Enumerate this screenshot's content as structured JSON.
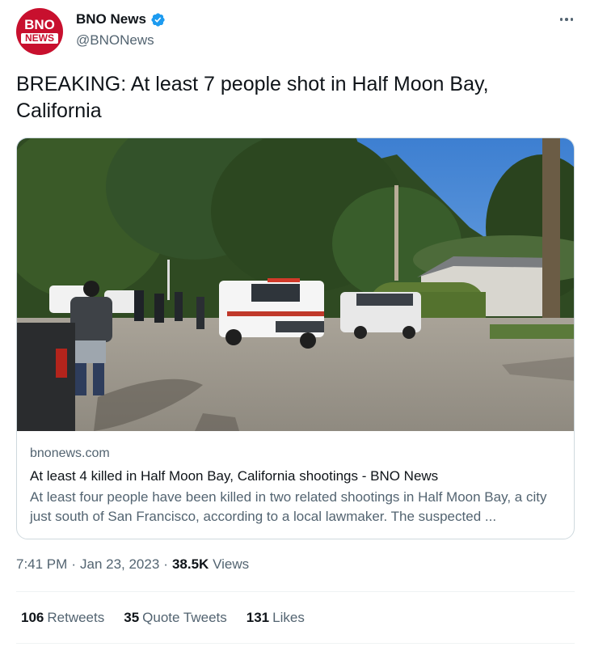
{
  "account": {
    "avatar_text_top": "BNO",
    "avatar_text_bottom": "NEWS",
    "display_name": "BNO News",
    "handle": "@BNONews",
    "verified_color": "#1d9bf0"
  },
  "tweet": {
    "text": "BREAKING: At least 7 people shot in Half Moon Bay, California"
  },
  "card": {
    "domain": "bnonews.com",
    "title": "At least 4 killed in Half Moon Bay, California shootings - BNO News",
    "description": "At least four people have been killed in two related shootings in Half Moon Bay, a city just south of San Francisco, according to a local lawmaker. The suspected ..."
  },
  "meta": {
    "time": "7:41 PM",
    "separator": "·",
    "date": "Jan 23, 2023",
    "views_count": "38.5K",
    "views_label": "Views"
  },
  "stats": {
    "retweets_count": "106",
    "retweets_label": "Retweets",
    "quotes_count": "35",
    "quotes_label": "Quote Tweets",
    "likes_count": "131",
    "likes_label": "Likes"
  },
  "colors": {
    "brand_red": "#c8102e",
    "secondary_text": "#536471",
    "primary_text": "#0f1419",
    "border": "#cfd9de"
  }
}
